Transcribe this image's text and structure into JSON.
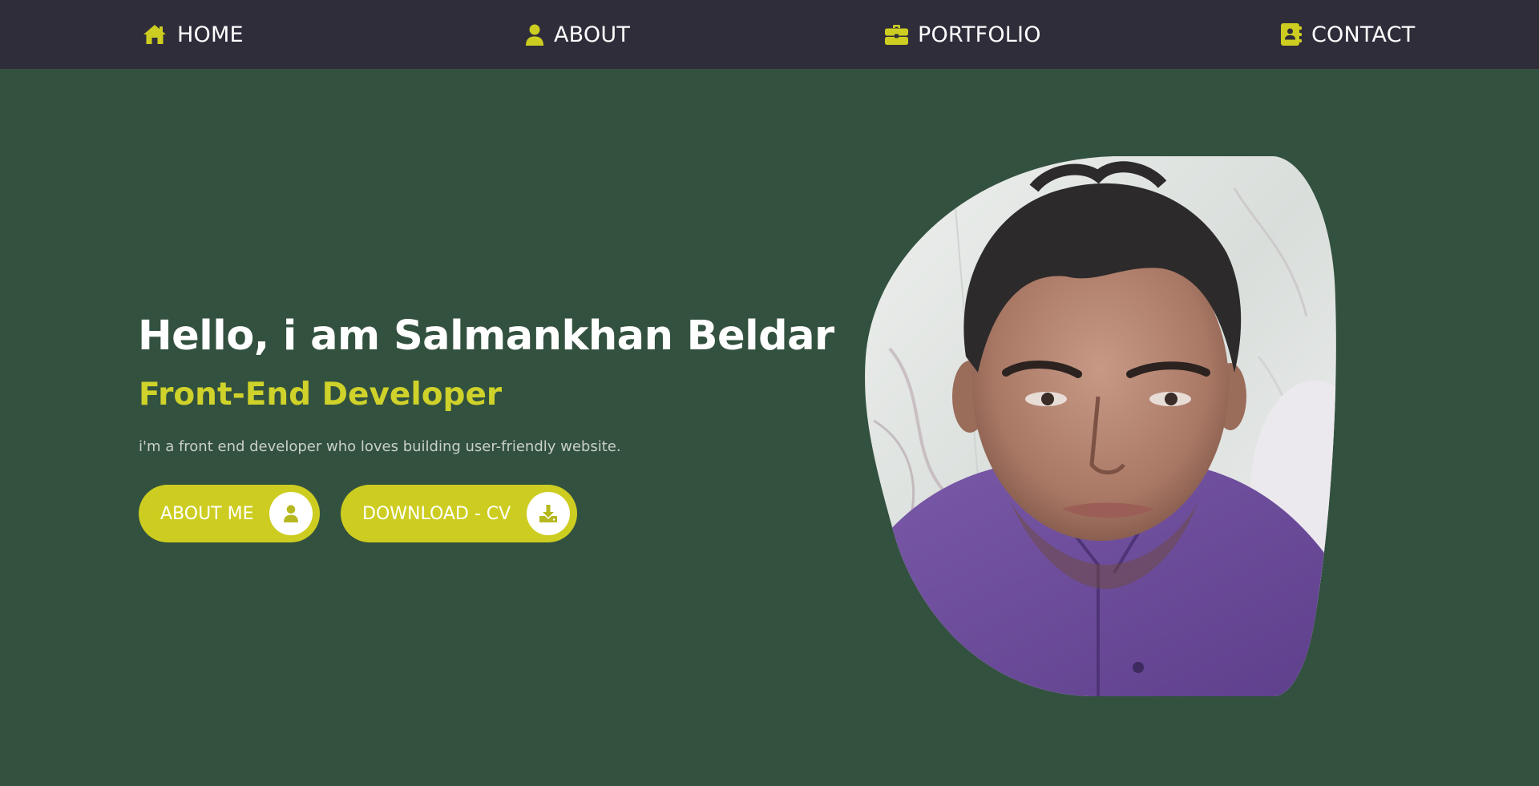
{
  "nav": {
    "items": [
      {
        "label": "HOME",
        "icon": "home-icon"
      },
      {
        "label": "ABOUT",
        "icon": "user-icon"
      },
      {
        "label": "PORTFOLIO",
        "icon": "briefcase-icon"
      },
      {
        "label": "CONTACT",
        "icon": "address-book-icon"
      }
    ]
  },
  "hero": {
    "title": "Hello, i am Salmankhan Beldar",
    "subtitle": "Front-End Developer",
    "description": "i'm a front end developer who loves building user-friendly website.",
    "buttons": [
      {
        "label": "ABOUT ME",
        "icon": "user-icon"
      },
      {
        "label": "DOWNLOAD - CV",
        "icon": "download-icon"
      }
    ],
    "portrait": "profile-photo"
  },
  "colors": {
    "nav_background": "#2f2d3a",
    "page_background": "#33513f",
    "accent": "#cdcd21",
    "text": "#ffffff"
  }
}
